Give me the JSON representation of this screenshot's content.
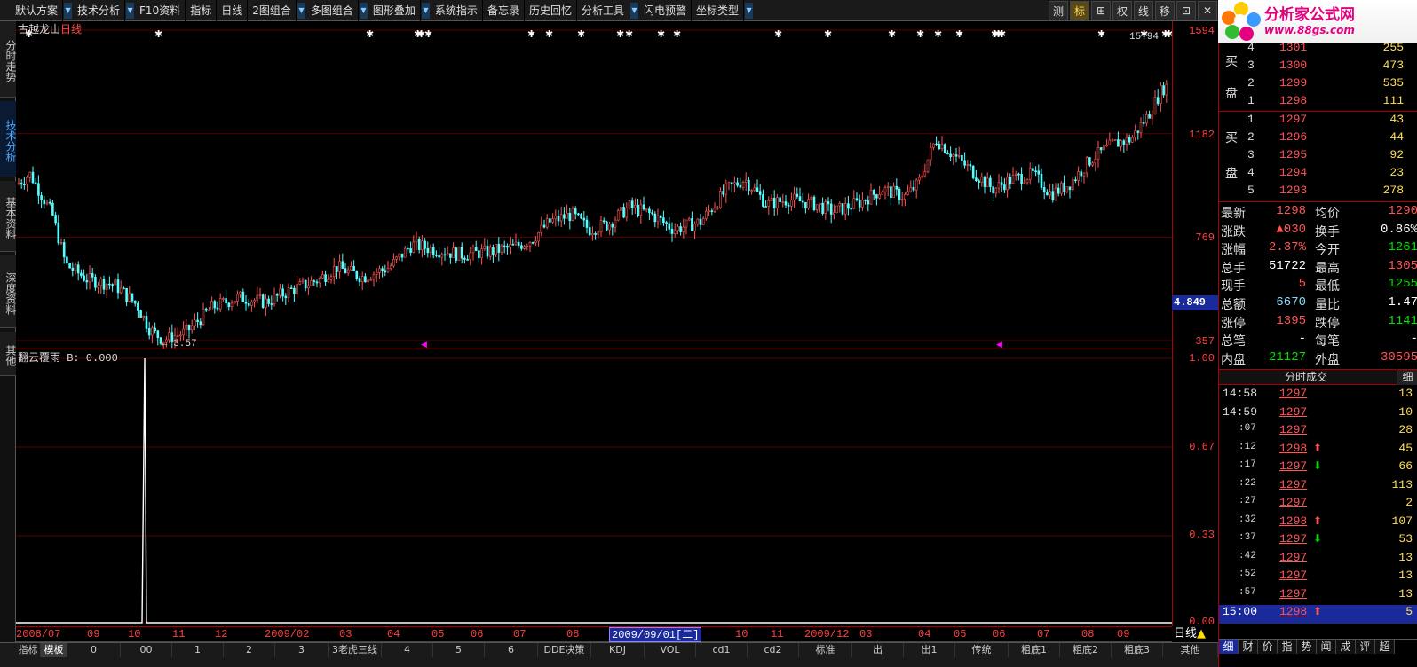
{
  "toolbar": {
    "items": [
      "默认方案",
      "技术分析",
      "F10资料",
      "指标",
      "日线",
      "2图组合",
      "多图组合",
      "图形叠加",
      "系统指示",
      "备忘录",
      "历史回忆",
      "分析工具",
      "闪电预警",
      "坐标类型"
    ],
    "right_buttons": [
      "测",
      "标",
      "⊞",
      "权",
      "线",
      "移",
      "⊡",
      "✕"
    ],
    "active_right": "标"
  },
  "logo": {
    "brand": "分析家公式网",
    "url": "www.88gs.com"
  },
  "left_tabs": [
    "分时走势",
    "技术分析",
    "基本资料",
    "深度资料",
    "其他"
  ],
  "stock": {
    "name": "古越龙山",
    "period": "日线"
  },
  "price_axis": {
    "labels": [
      "1594",
      "1182",
      "769",
      "357"
    ],
    "cursor_value": "4.849"
  },
  "chart_annotations": {
    "high_label": "15.94",
    "low_label": "3.57"
  },
  "indicator": {
    "title": "翻云覆雨 B: 0.000",
    "axis": [
      "1.00",
      "0.67",
      "0.33",
      "0.00"
    ]
  },
  "date_axis": {
    "labels": [
      "2008/07",
      "09",
      "10",
      "11",
      "12",
      "2009/02",
      "03",
      "04",
      "05",
      "06",
      "07",
      "08",
      "10",
      "11",
      "2009/12",
      "03",
      "04",
      "05",
      "06",
      "07",
      "08",
      "09"
    ],
    "highlight": "2009/09/01[二]",
    "period": "日线"
  },
  "bottom_tabs": [
    "指标",
    "模板",
    "0",
    "00",
    "1",
    "2",
    "3",
    "3老虎三线",
    "4",
    "5",
    "6",
    "DDE决策",
    "KDJ",
    "VOL",
    "cd1",
    "cd2",
    "标准",
    "出",
    "出1",
    "传统",
    "粗底1",
    "粗底2",
    "粗底3",
    "其他"
  ],
  "order_book": {
    "sell_label": [
      "买",
      "盘"
    ],
    "sell": [
      {
        "lvl": "4",
        "price": "1301",
        "vol": "255"
      },
      {
        "lvl": "3",
        "price": "1300",
        "vol": "473"
      },
      {
        "lvl": "2",
        "price": "1299",
        "vol": "535"
      },
      {
        "lvl": "1",
        "price": "1298",
        "vol": "111"
      }
    ],
    "buy_label": [
      "买",
      "盘"
    ],
    "buy": [
      {
        "lvl": "1",
        "price": "1297",
        "vol": "43"
      },
      {
        "lvl": "2",
        "price": "1296",
        "vol": "44"
      },
      {
        "lvl": "3",
        "price": "1295",
        "vol": "92"
      },
      {
        "lvl": "4",
        "price": "1294",
        "vol": "23"
      },
      {
        "lvl": "5",
        "price": "1293",
        "vol": "278"
      }
    ]
  },
  "stats": [
    {
      "k1": "最新",
      "v1": "1298",
      "c1": "#ff5555",
      "k2": "均价",
      "v2": "1290",
      "c2": "#ff5555"
    },
    {
      "k1": "涨跌",
      "v1": "▲030",
      "c1": "#ff5555",
      "k2": "换手",
      "v2": "0.86%",
      "c2": "#ffffff"
    },
    {
      "k1": "涨幅",
      "v1": "2.37%",
      "c1": "#ff5555",
      "k2": "今开",
      "v2": "1261",
      "c2": "#00e000"
    },
    {
      "k1": "总手",
      "v1": "51722",
      "c1": "#ffffff",
      "k2": "最高",
      "v2": "1305",
      "c2": "#ff5555"
    },
    {
      "k1": "现手",
      "v1": "5",
      "c1": "#ff5555",
      "k2": "最低",
      "v2": "1255",
      "c2": "#00e000"
    },
    {
      "k1": "总额",
      "v1": "6670",
      "c1": "#88ddff",
      "k2": "量比",
      "v2": "1.47",
      "c2": "#ffffff"
    },
    {
      "k1": "涨停",
      "v1": "1395",
      "c1": "#ff5555",
      "k2": "跌停",
      "v2": "1141",
      "c2": "#00e000"
    },
    {
      "k1": "总笔",
      "v1": "-",
      "c1": "#ffffff",
      "k2": "每笔",
      "v2": "-",
      "c2": "#ffffff"
    },
    {
      "k1": "内盘",
      "v1": "21127",
      "c1": "#00e000",
      "k2": "外盘",
      "v2": "30595",
      "c2": "#ff5555"
    }
  ],
  "ticks": {
    "header": "分时成交",
    "detail": "细",
    "rows": [
      {
        "t": "14:58",
        "p": "1297",
        "a": "",
        "v": "13",
        "short": false
      },
      {
        "t": "14:59",
        "p": "1297",
        "a": "",
        "v": "10",
        "short": false
      },
      {
        "t": ":07",
        "p": "1297",
        "a": "",
        "v": "28",
        "short": true
      },
      {
        "t": ":12",
        "p": "1298",
        "a": "up",
        "v": "45",
        "short": true
      },
      {
        "t": ":17",
        "p": "1297",
        "a": "down",
        "v": "66",
        "short": true
      },
      {
        "t": ":22",
        "p": "1297",
        "a": "",
        "v": "113",
        "short": true
      },
      {
        "t": ":27",
        "p": "1297",
        "a": "",
        "v": "2",
        "short": true
      },
      {
        "t": ":32",
        "p": "1298",
        "a": "up",
        "v": "107",
        "short": true
      },
      {
        "t": ":37",
        "p": "1297",
        "a": "down",
        "v": "53",
        "short": true
      },
      {
        "t": ":42",
        "p": "1297",
        "a": "",
        "v": "13",
        "short": true
      },
      {
        "t": ":52",
        "p": "1297",
        "a": "",
        "v": "13",
        "short": true
      },
      {
        "t": ":57",
        "p": "1297",
        "a": "",
        "v": "13",
        "short": true
      },
      {
        "t": "15:00",
        "p": "1298",
        "a": "up",
        "v": "5",
        "short": false
      }
    ]
  },
  "right_bottom_tabs": [
    "细",
    "财",
    "价",
    "指",
    "势",
    "闻",
    "成",
    "评",
    "超"
  ]
}
